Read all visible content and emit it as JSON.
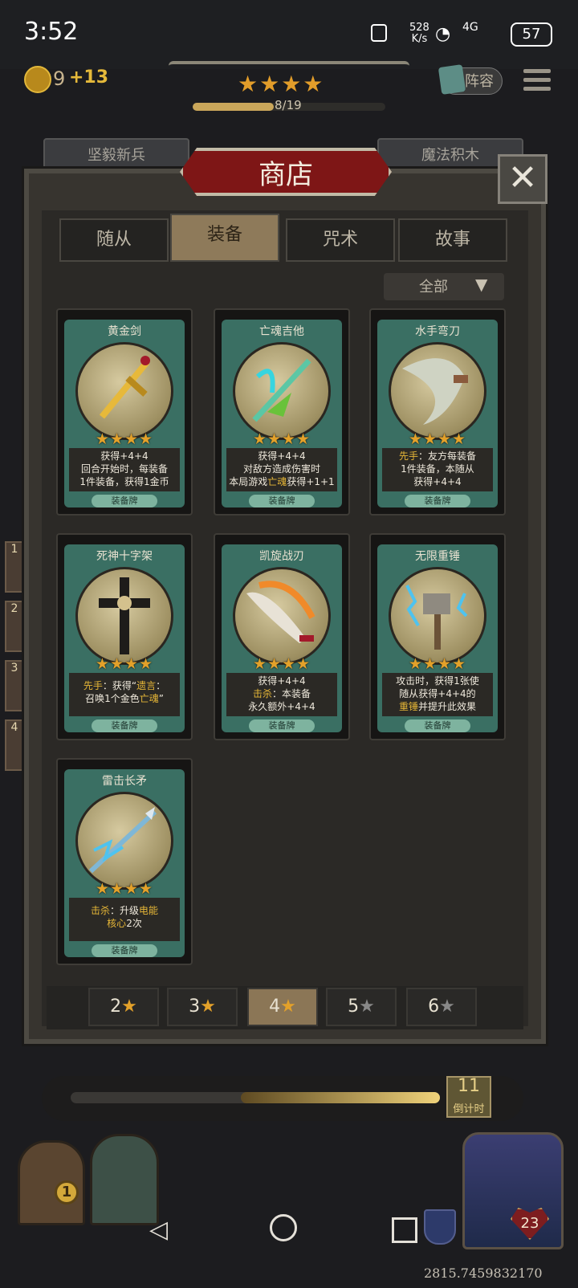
{
  "status": {
    "time": "3:52",
    "net_speed": "528",
    "net_unit": "K/s",
    "net_type": "4G",
    "battery": "57"
  },
  "hud": {
    "gold": "9",
    "gold_gain": "+13",
    "stars": "★★★★",
    "progress_text": "8/19",
    "progress": 0.42,
    "lineup_label": "阵容"
  },
  "back_tabs": [
    "坚毅新兵",
    "魔法积木"
  ],
  "shop": {
    "title": "商店",
    "close": "✕"
  },
  "categories": [
    "随从",
    "装备",
    "咒术",
    "故事"
  ],
  "active_category": "装备",
  "filter": {
    "label": "全部",
    "icon": "▼"
  },
  "cards": [
    {
      "name": "黄金剑",
      "stars": "★★★★",
      "desc_1": "获得+4+4",
      "desc_2": "回合开始时，每装备",
      "desc_3": "1件装备，获得1金币",
      "type": "装备牌",
      "icon": "golden-sword-icon"
    },
    {
      "name": "亡魂吉他",
      "stars": "★★★★",
      "desc_1": "获得+4+4",
      "desc_2": "对敌方造成伤害时",
      "desc_3a": "本局游戏",
      "desc_3kw": "亡魂",
      "desc_3b": "获得+1+1",
      "type": "装备牌",
      "icon": "soul-guitar-icon"
    },
    {
      "name": "水手弯刀",
      "stars": "★★★★",
      "desc_1kw": "先手",
      "desc_1": "：友方每装备",
      "desc_2": "1件装备，本随从",
      "desc_3": "获得+4+4",
      "type": "装备牌",
      "icon": "sailor-scimitar-icon"
    },
    {
      "name": "死神十字架",
      "stars": "★★★★",
      "desc_1kw": "先手",
      "desc_1a": "：获得“",
      "desc_1kw2": "遗言",
      "desc_1b": "：",
      "desc_2a": "召唤1个金色",
      "desc_2kw": "亡魂",
      "desc_2b": "”",
      "type": "装备牌",
      "icon": "death-cross-icon"
    },
    {
      "name": "凯旋战刃",
      "stars": "★★★★",
      "desc_1": "获得+4+4",
      "desc_2kw": "击杀",
      "desc_2": "：本装备",
      "desc_3": "永久额外+4+4",
      "type": "装备牌",
      "icon": "triumph-blade-icon"
    },
    {
      "name": "无限重锤",
      "stars": "★★★★",
      "desc_1": "攻击时，获得1张使",
      "desc_2": "随从获得+4+4的",
      "desc_3kw": "重锤",
      "desc_3": "并提升此效果",
      "type": "装备牌",
      "icon": "infinite-hammer-icon"
    },
    {
      "name": "雷击长矛",
      "stars": "★★★★",
      "desc_1kw": "击杀",
      "desc_1a": "：升级",
      "desc_1kw2": "电能",
      "desc_2kw": "核心",
      "desc_2": "2次",
      "type": "装备牌",
      "icon": "thunder-spear-icon"
    }
  ],
  "star_filters": [
    {
      "num": "2",
      "star": "★"
    },
    {
      "num": "3",
      "star": "★"
    },
    {
      "num": "4",
      "star": "★"
    },
    {
      "num": "5",
      "star": "★"
    },
    {
      "num": "6",
      "star": "★"
    }
  ],
  "active_star_filter": "4",
  "bottom": {
    "countdown": "11",
    "countdown_label": "倒计时",
    "timer_progress": 0.54,
    "reroll_count": "1",
    "hp": "23",
    "coord": "2815.7459832170"
  },
  "side_slots": [
    "1",
    "2",
    "3",
    "4"
  ],
  "colors": {
    "accent_gold": "#e3a12a",
    "title_red": "#7e1616",
    "card_green": "#3a6f63",
    "keyword": "#e6b637"
  }
}
